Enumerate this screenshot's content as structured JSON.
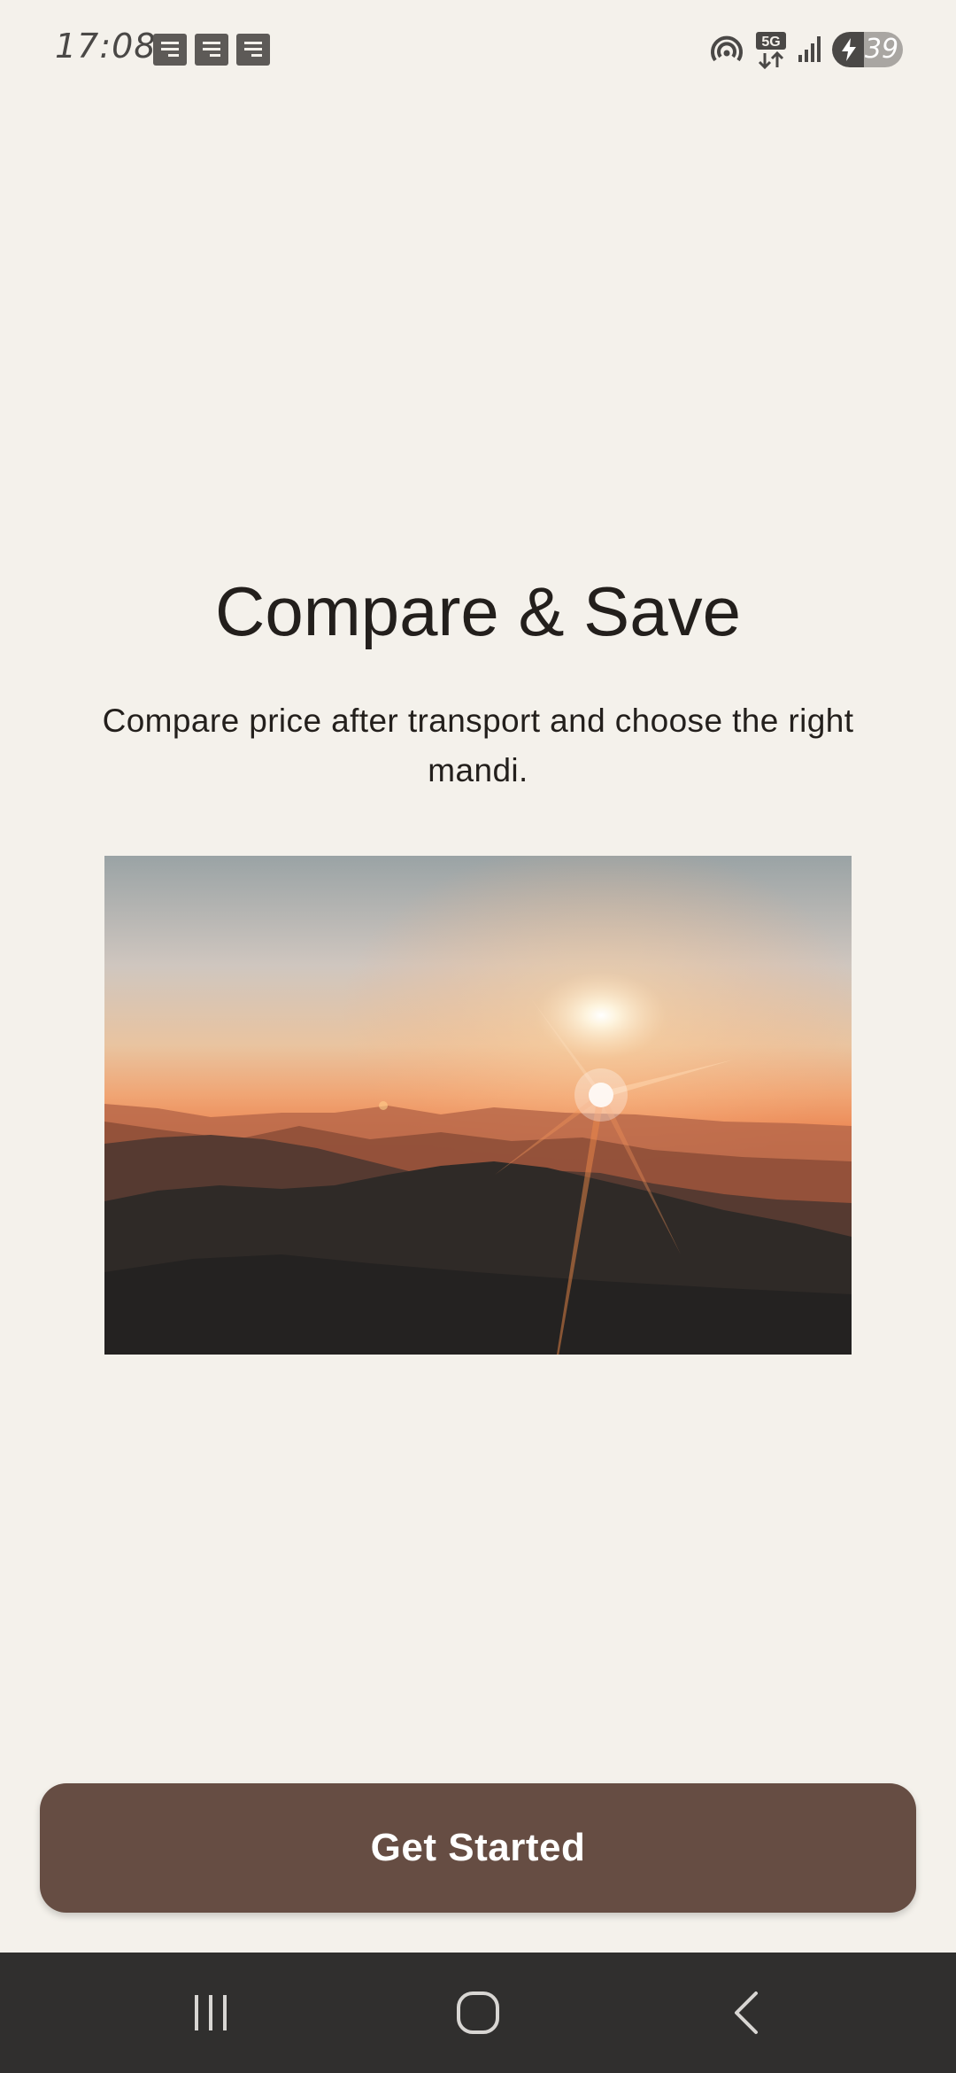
{
  "status_bar": {
    "time": "17:08",
    "battery_level": "39",
    "network_label": "5G",
    "icons": [
      "notification-icon",
      "notification-icon",
      "notification-icon",
      "hotspot-icon",
      "5g-data-icon",
      "signal-icon",
      "battery-charging-icon"
    ]
  },
  "onboarding": {
    "title": "Compare & Save",
    "description": "Compare price after transport and choose the right mandi.",
    "image_icon": "sunset-mountains-image"
  },
  "cta": {
    "label": "Get Started"
  },
  "nav_bar": {
    "icons": [
      "recents-icon",
      "home-icon",
      "back-icon"
    ]
  },
  "colors": {
    "background": "#f4f1eb",
    "text": "#231f1c",
    "button": "#664d43",
    "button_text": "#ffffff",
    "nav_bar": "#302f2e"
  }
}
